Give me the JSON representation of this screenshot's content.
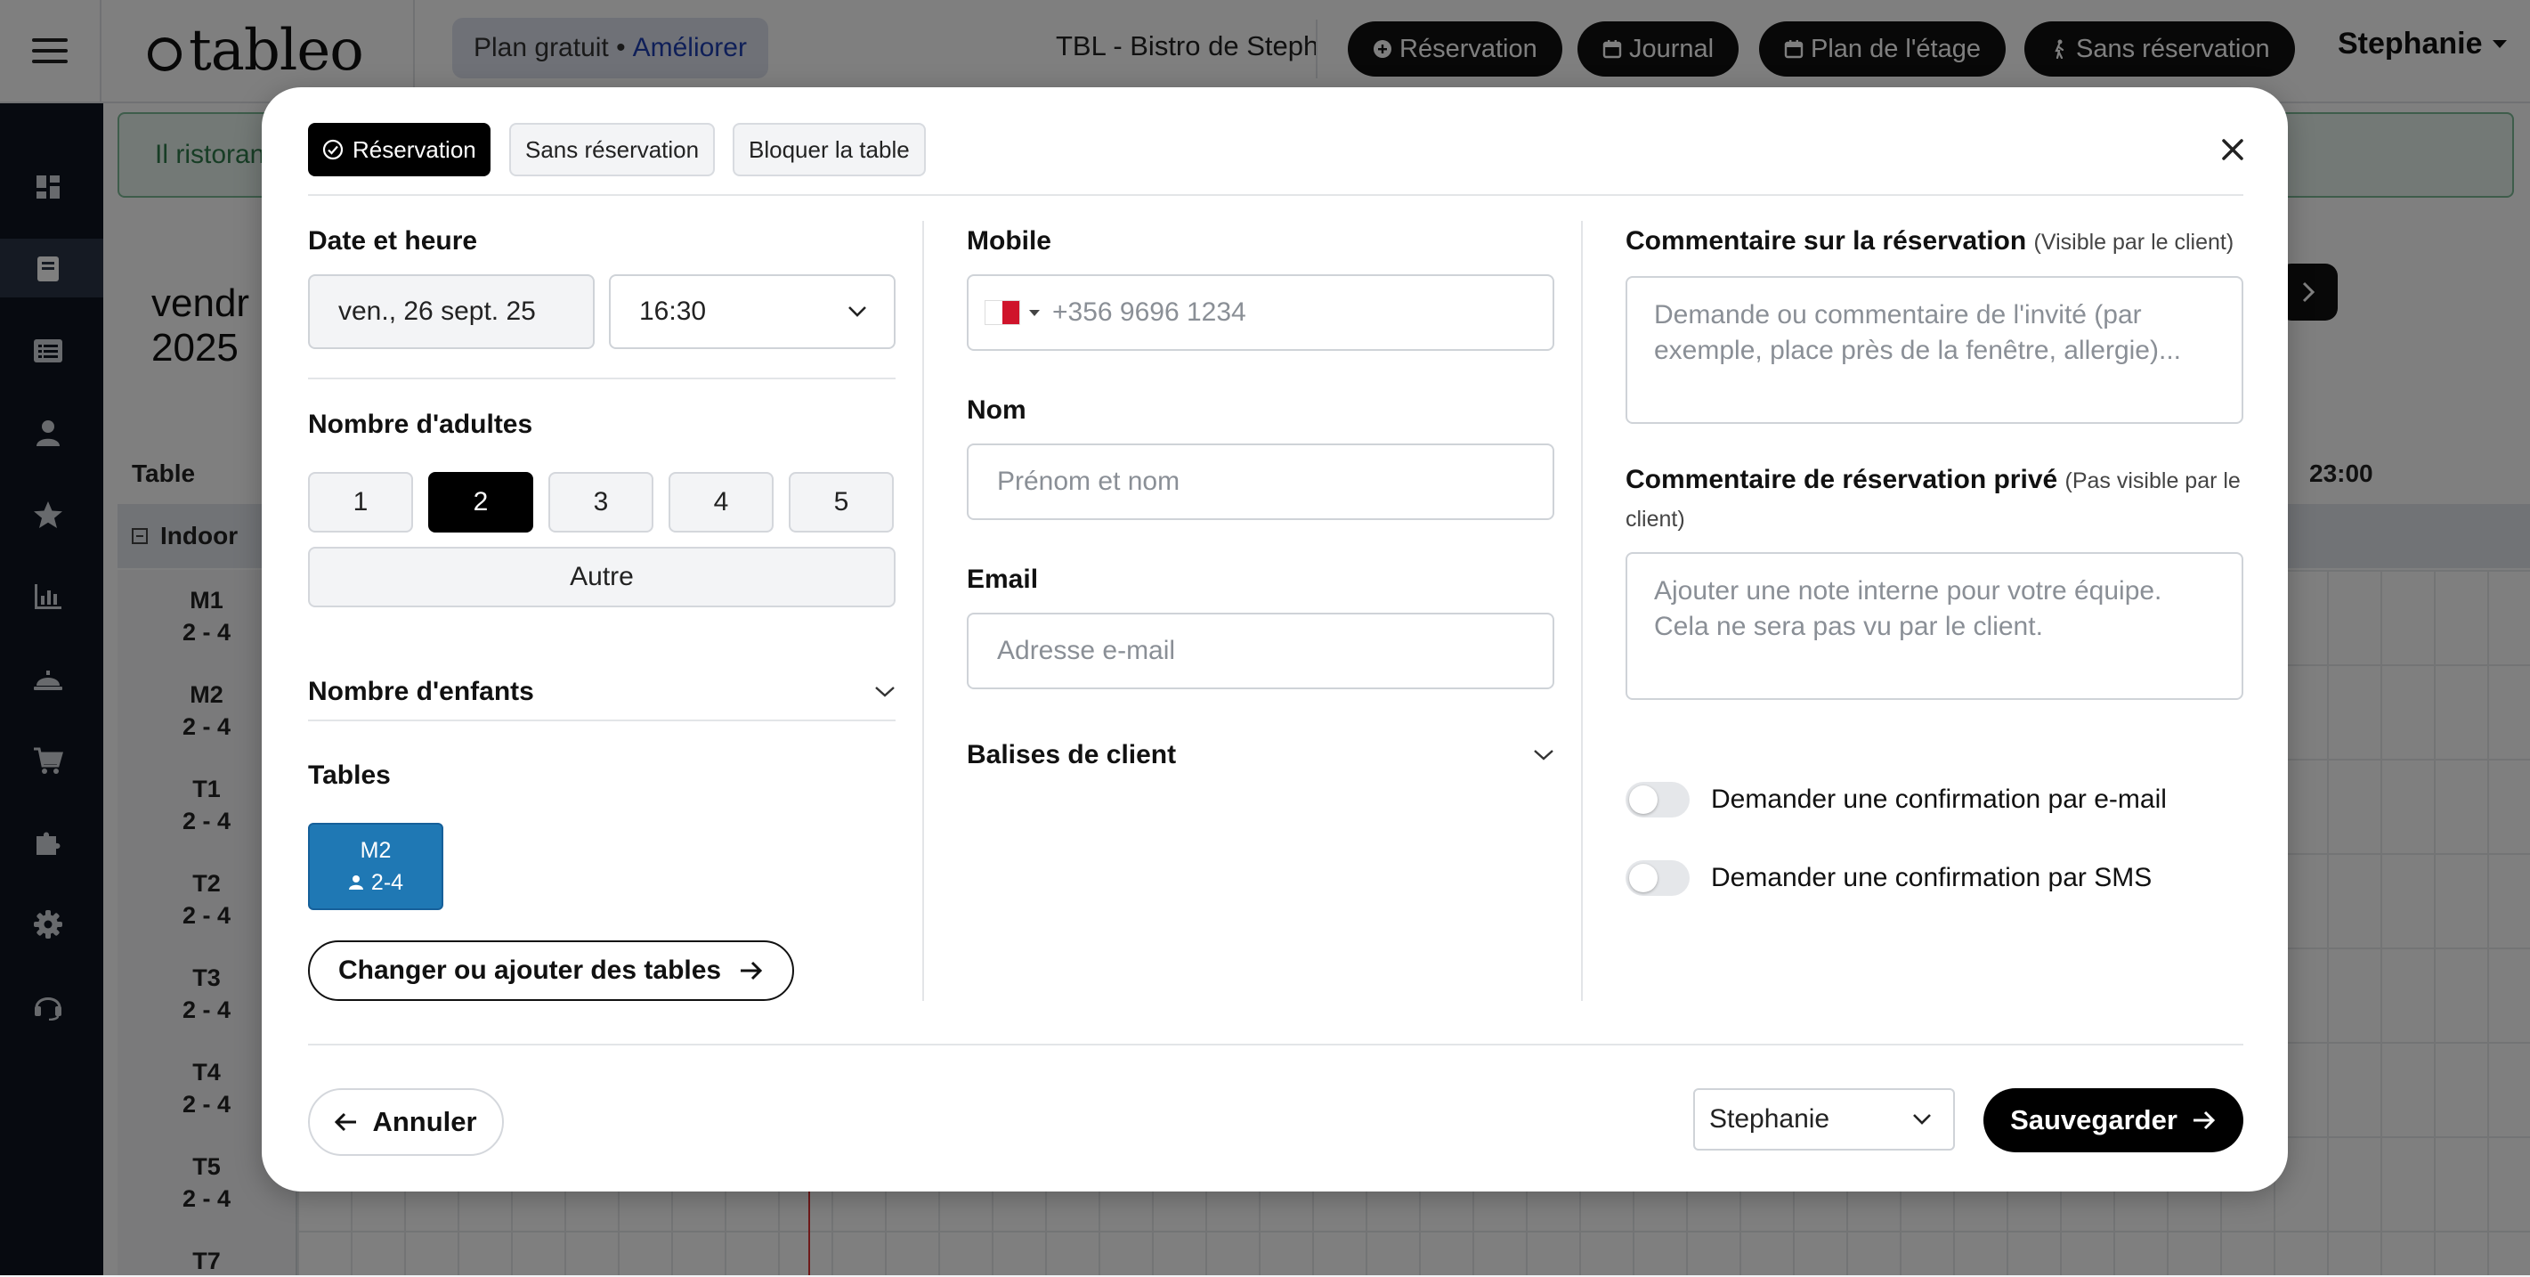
{
  "topbar": {
    "logo_text": "tableo",
    "plan_label": "Plan gratuit •",
    "plan_upgrade": "Améliorer",
    "restaurant": "TBL - Bistro de Steph",
    "nav": {
      "reservation": "Réservation",
      "journal": "Journal",
      "floorplan": "Plan de l'étage",
      "walkin": "Sans réservation"
    },
    "user": "Stephanie"
  },
  "sidebar": {
    "icons": [
      "dashboard-icon",
      "reservations-book-icon",
      "list-icon",
      "guests-icon",
      "star-icon",
      "reports-chart-icon",
      "service-bell-icon",
      "cart-icon",
      "integrations-puzzle-icon",
      "settings-gear-icon",
      "support-headset-icon"
    ],
    "active_index": 1
  },
  "background": {
    "alert_text": "Il ristoran",
    "date_title_line1": "vendr",
    "date_title_line2": "2025",
    "col_table": "Table",
    "col_time_last": "23:00",
    "section": "Indoor",
    "tables": [
      {
        "name": "M1",
        "cap": "2 - 4"
      },
      {
        "name": "M2",
        "cap": "2 - 4"
      },
      {
        "name": "T1",
        "cap": "2 - 4"
      },
      {
        "name": "T2",
        "cap": "2 - 4"
      },
      {
        "name": "T3",
        "cap": "2 - 4"
      },
      {
        "name": "T4",
        "cap": "2 - 4"
      },
      {
        "name": "T5",
        "cap": "2 - 4"
      },
      {
        "name": "T7",
        "cap": ""
      }
    ]
  },
  "modal": {
    "tabs": {
      "reservation": "Réservation",
      "walkin": "Sans réservation",
      "block": "Bloquer la table"
    },
    "date_time": {
      "label": "Date et heure",
      "date_value": "ven., 26 sept. 25",
      "time_value": "16:30"
    },
    "adults": {
      "label": "Nombre d'adultes",
      "options": [
        "1",
        "2",
        "3",
        "4",
        "5"
      ],
      "selected": "2",
      "other": "Autre"
    },
    "children_label": "Nombre d'enfants",
    "tables": {
      "label": "Tables",
      "chip_name": "M2",
      "chip_capacity": "2-4",
      "change_button": "Changer ou ajouter des tables"
    },
    "mobile": {
      "label": "Mobile",
      "placeholder": "+356 9696 1234",
      "country_flag": "malta-flag-icon"
    },
    "name": {
      "label": "Nom",
      "placeholder": "Prénom et nom"
    },
    "email": {
      "label": "Email",
      "placeholder": "Adresse e-mail"
    },
    "tags_label": "Balises de client",
    "comment": {
      "label": "Commentaire sur la réservation",
      "sublabel": "(Visible par le client)",
      "placeholder": "Demande ou commentaire de l'invité (par exemple, place près de la fenêtre, allergie)..."
    },
    "private_comment": {
      "label": "Commentaire de réservation privé",
      "sublabel": "(Pas visible par le client)",
      "placeholder": "Ajouter une note interne pour votre équipe. Cela ne sera pas vu par le client."
    },
    "toggles": {
      "email_label": "Demander une confirmation par e-mail",
      "email_on": false,
      "sms_label": "Demander une confirmation par SMS",
      "sms_on": false
    },
    "footer": {
      "cancel": "Annuler",
      "staff_value": "Stephanie",
      "save": "Sauvegarder"
    }
  }
}
